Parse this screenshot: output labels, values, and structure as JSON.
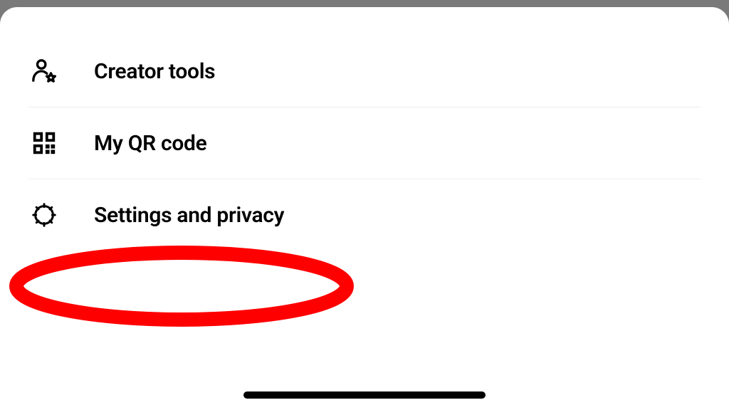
{
  "menu": {
    "items": [
      {
        "label": "Creator tools",
        "icon": "creator-tools-icon"
      },
      {
        "label": "My QR code",
        "icon": "qr-code-icon"
      },
      {
        "label": "Settings and privacy",
        "icon": "gear-icon"
      }
    ]
  },
  "annotation": {
    "highlighted_index": 2,
    "color": "#ff0000"
  }
}
